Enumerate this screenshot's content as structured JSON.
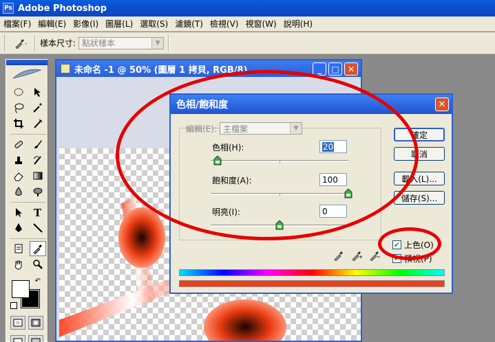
{
  "app": {
    "title": "Adobe Photoshop",
    "logo": "Ps"
  },
  "menu": [
    "檔案(F)",
    "編輯(E)",
    "影像(I)",
    "圖層(L)",
    "選取(S)",
    "濾鏡(T)",
    "檢視(V)",
    "視窗(W)",
    "說明(H)"
  ],
  "options": {
    "sample_size_label": "樣本尺寸:",
    "sample_size_value": "點狀樣本"
  },
  "document": {
    "title": "未命名 -1 @ 50% (圖層 1 拷貝, RGB/8)"
  },
  "dialog": {
    "title": "色相/飽和度",
    "edit_label": "編輯(E):",
    "edit_value": "主檔案",
    "hue_label": "色相(H):",
    "hue_value": "20",
    "saturation_label": "飽和度(A):",
    "saturation_value": "100",
    "lightness_label": "明亮(I):",
    "lightness_value": "0",
    "hue_level": 20,
    "saturation_level": 100,
    "lightness_level": 0,
    "ok_label": "確定",
    "cancel_label": "取消",
    "load_label": "載入(L)...",
    "save_label": "儲存(S)...",
    "colorize_label": "上色(O)",
    "colorize_checked": true,
    "preview_label": "預視(P)",
    "preview_checked": true
  },
  "colors": {
    "accent": "#e60000",
    "result_bar": "#f0401a",
    "titlebar": "#2b60d6"
  },
  "icons": [
    "eyedropper-icon",
    "feather-icon",
    "close-icon",
    "minimize-icon",
    "maximize-icon"
  ]
}
